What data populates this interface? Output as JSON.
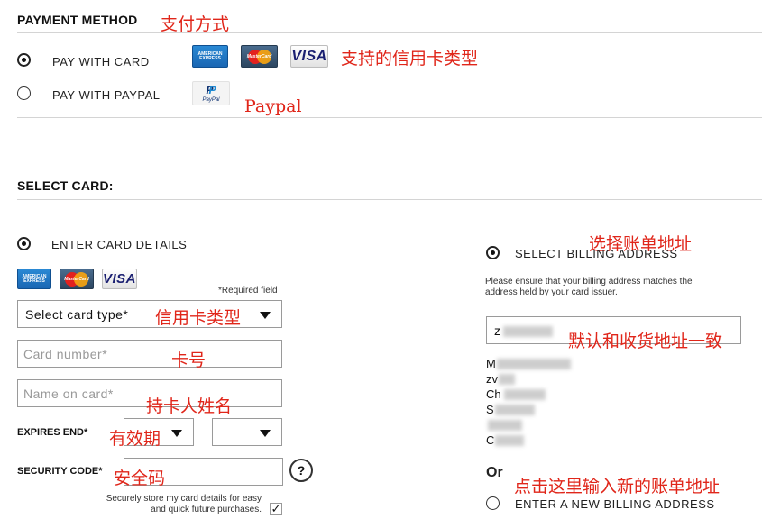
{
  "payment_method": {
    "title": "PAYMENT METHOD",
    "annotation": "支付方式",
    "options": [
      {
        "label": "PAY WITH CARD",
        "selected": true
      },
      {
        "label": "PAY WITH PAYPAL",
        "selected": false
      }
    ],
    "card_types_annotation": "支持的信用卡类型",
    "paypal_annotation": "Paypal",
    "logos": {
      "amex_line1": "AMERICAN",
      "amex_line2": "EXPRESS",
      "mastercard": "MasterCard",
      "visa": "VISA",
      "paypal_mark": "P",
      "paypal_word": "PayPal"
    }
  },
  "select_card": {
    "title": "SELECT CARD:",
    "enter_details_label": "ENTER CARD DETAILS",
    "enter_details_selected": true,
    "required_note": "*Required field",
    "card_type": {
      "value": "Select card type*",
      "annotation": "信用卡类型"
    },
    "card_number": {
      "placeholder": "Card number*",
      "annotation": "卡号"
    },
    "name_on_card": {
      "placeholder": "Name on card*",
      "annotation": "持卡人姓名"
    },
    "expires": {
      "label": "EXPIRES END*",
      "annotation": "有效期",
      "month": "",
      "year": ""
    },
    "security": {
      "label": "SECURITY CODE*",
      "annotation": "安全码",
      "help": "?"
    },
    "store": {
      "line1": "Securely store my card details for easy",
      "line2": "and quick future purchases.",
      "checked": true,
      "check_glyph": "✓"
    }
  },
  "billing": {
    "select_label": "SELECT BILLING ADDRESS",
    "select_selected": true,
    "select_annotation": "选择账单地址",
    "note_line1": "Please ensure that your billing address matches the",
    "note_line2": "address held by your card issuer.",
    "address_value": "z",
    "default_annotation": "默认和收货地址一致",
    "address_lines": [
      "M",
      "zv",
      "Ch",
      "S",
      "",
      "C"
    ],
    "or_label": "Or",
    "new_address_label": "ENTER A NEW BILLING ADDRESS",
    "new_address_selected": false,
    "new_address_annotation": "点击这里输入新的账单地址"
  },
  "colors": {
    "annotation": "#e0261a",
    "rule": "#d4d4d4",
    "field_border": "#9a9a9a"
  }
}
